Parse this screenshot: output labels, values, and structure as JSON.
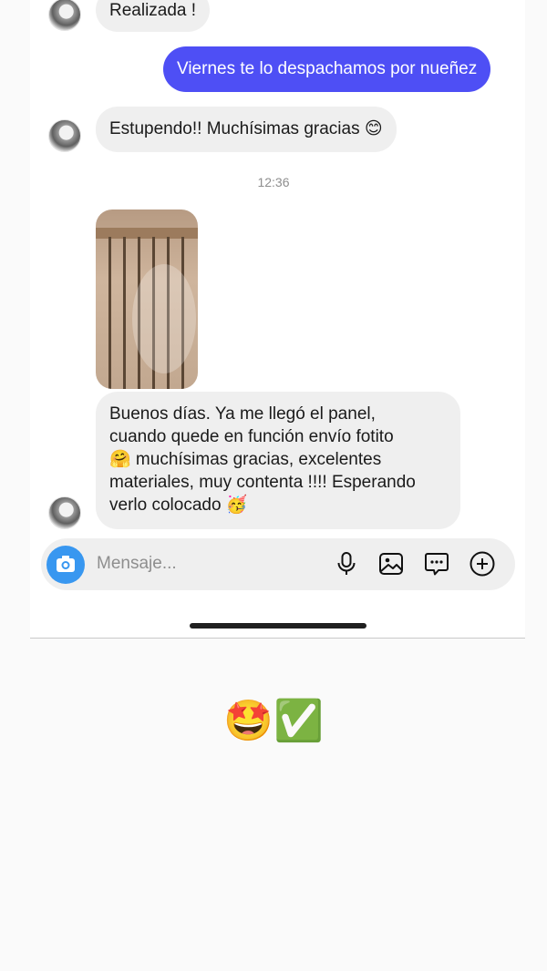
{
  "chat": {
    "messages": [
      {
        "id": "m1",
        "direction": "incoming",
        "text": "Realizada !"
      },
      {
        "id": "m2",
        "direction": "outgoing",
        "text": "Viernes te lo despachamos por nueñez"
      },
      {
        "id": "m3",
        "direction": "incoming",
        "text": "Estupendo!! Muchísimas gracias 😊"
      },
      {
        "id": "m4",
        "direction": "incoming",
        "type": "photo"
      },
      {
        "id": "m5",
        "direction": "incoming",
        "lines": [
          "Buenos días. Ya me llegó el panel,",
          "cuando quede en función envío fotito",
          "🤗 muchísimas gracias, excelentes",
          "materiales, muy contenta !!!! Esperando",
          "verlo colocado 🥳"
        ]
      }
    ],
    "timestamp": "12:36"
  },
  "composer": {
    "placeholder": "Mensaje...",
    "icons": [
      "camera-icon",
      "microphone-icon",
      "image-icon",
      "sticker-icon",
      "add-icon"
    ]
  },
  "caption": {
    "emoji": "🤩✅"
  },
  "colors": {
    "outgoing_bubble": "#4e4ff5",
    "incoming_bubble": "#efefef",
    "camera_button": "#3897f0"
  }
}
